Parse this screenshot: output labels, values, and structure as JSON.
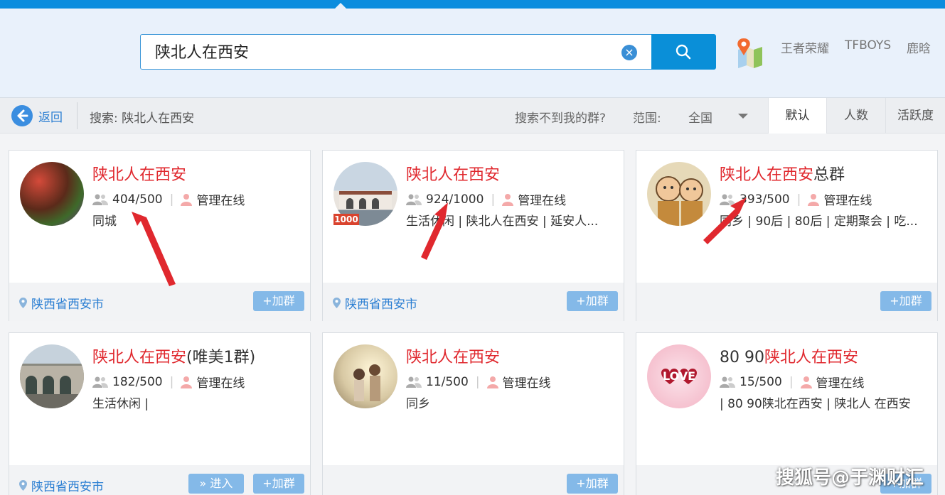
{
  "search": {
    "query": "陕北人在西安",
    "clear_label": "×"
  },
  "hot_searches": [
    "王者荣耀",
    "TFBOYS",
    "鹿晗"
  ],
  "filter": {
    "back_label": "返回",
    "breadcrumb": "搜索: 陕北人在西安",
    "cant_find": "搜索不到我的群?",
    "range_label": "范围:",
    "range_value": "全国",
    "sort_tabs": [
      "默认",
      "人数",
      "活跃度"
    ]
  },
  "groups": [
    {
      "title_highlight": "陕北人在西安",
      "title_suffix": "",
      "title_prefix": "",
      "members": "404/500",
      "admin": "管理在线",
      "tags": "同城",
      "location": "陕西省西安市",
      "join": "+加群"
    },
    {
      "title_highlight": "陕北人在西安",
      "title_suffix": "",
      "title_prefix": "",
      "members": "924/1000",
      "admin": "管理在线",
      "tags": "生活休闲 | 陕北人在西安 | 延安人...",
      "location": "陕西省西安市",
      "join": "+加群",
      "badge": "1000"
    },
    {
      "title_highlight": "陕北人在西安",
      "title_suffix": "总群",
      "title_prefix": "",
      "members": "393/500",
      "admin": "管理在线",
      "tags": "同乡 | 90后 | 80后 | 定期聚会 | 吃...",
      "location": "",
      "join": "+加群"
    },
    {
      "title_highlight": "陕北人在西安",
      "title_suffix": "(唯美1群)",
      "title_prefix": "",
      "members": "182/500",
      "admin": "管理在线",
      "tags": "生活休闲 |",
      "location": "陕西省西安市",
      "join": "+加群",
      "enter": "» 进入"
    },
    {
      "title_highlight": "陕北人在西安",
      "title_suffix": "",
      "title_prefix": "",
      "members": "11/500",
      "admin": "管理在线",
      "tags": "同乡",
      "location": "",
      "join": "+加群"
    },
    {
      "title_highlight": "陕北人在西安",
      "title_suffix": "",
      "title_prefix": "80 90",
      "members": "15/500",
      "admin": "管理在线",
      "tags": "| 80 90陕北在西安 | 陕北人 在西安",
      "location": "",
      "join": "+加群",
      "avatar_text": "LOVE"
    }
  ],
  "watermark": "搜狐号@于渊财汇",
  "colors": {
    "accent": "#0b8dde",
    "highlight": "#e0282e",
    "link": "#2a7ed2",
    "button": "#84b9e8"
  }
}
